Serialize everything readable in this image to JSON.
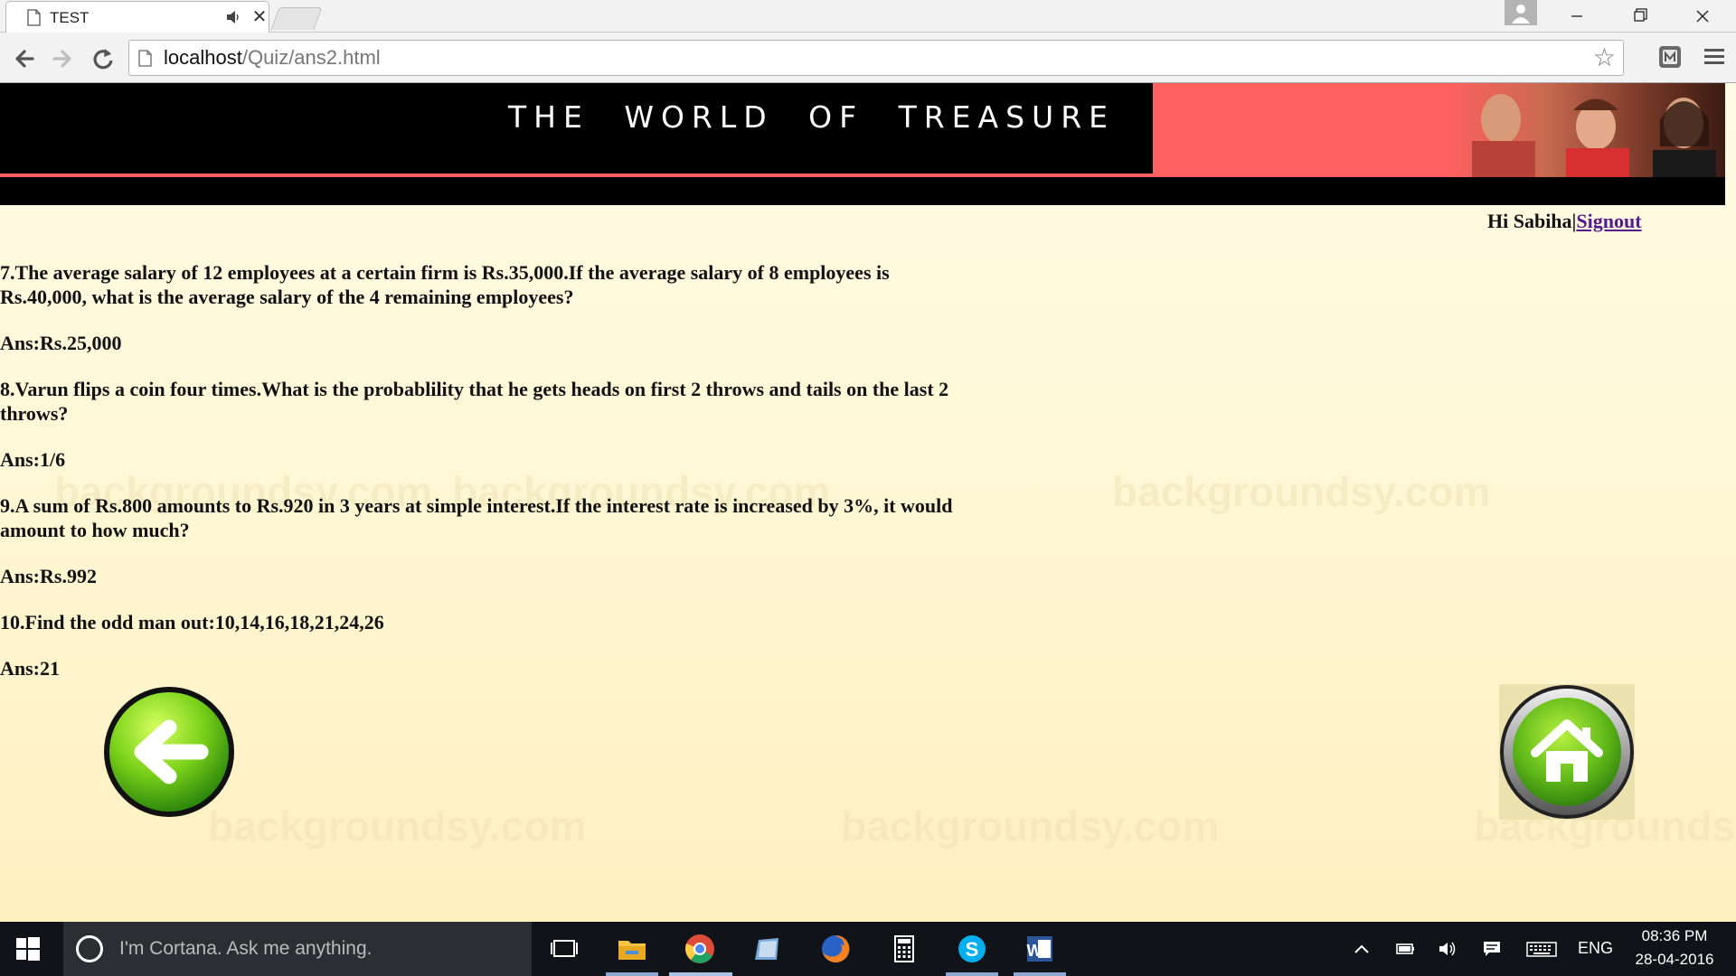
{
  "browser": {
    "tab": {
      "title": "TEST",
      "close": "✕"
    },
    "url": {
      "host": "localhost",
      "path": "/Quiz/ans2.html"
    }
  },
  "banner": {
    "title": "THE WORLD OF TREASURE"
  },
  "header": {
    "greeting": "Hi Sabiha|",
    "signout_label": "Signout"
  },
  "qa": [
    {
      "question": "7.The average salary of 12 employees at a certain firm is Rs.35,000.If the average salary of 8 employees is Rs.40,000, what is the average salary of the 4 remaining employees?",
      "answer": "Ans:Rs.25,000"
    },
    {
      "question": "8.Varun flips a coin four times.What is the probablility that he gets heads on first 2 throws and tails on the last 2 throws?",
      "answer": "Ans:1/6"
    },
    {
      "question": "9.A sum of Rs.800 amounts to Rs.920 in 3 years at simple interest.If the interest rate is increased by 3%, it would amount to how much?",
      "answer": "Ans:Rs.992"
    },
    {
      "question": "10.Find the odd man out:10,14,16,18,21,24,26",
      "answer": "Ans:21"
    }
  ],
  "watermark_text": "backgroundsy.com",
  "taskbar": {
    "cortana_placeholder": "I'm Cortana. Ask me anything.",
    "language": "ENG",
    "time": "08:36 PM",
    "date": "28-04-2016"
  },
  "colors": {
    "banner_bg": "#000000",
    "banner_accent": "#ff6060",
    "page_bg": "#fff8d8",
    "link": "#551a8b",
    "taskbar_bg": "#101418"
  }
}
